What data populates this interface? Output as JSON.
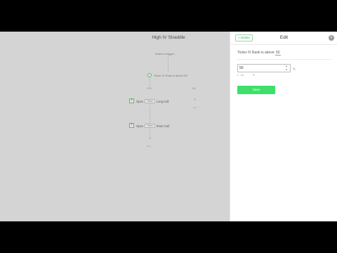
{
  "strategy": {
    "title": "High IV Straddle",
    "trigger": "Select a trigger...",
    "condition": "Ticker IV Rank is above 50",
    "branch_yes": "YES",
    "branch_no": "NO",
    "actions": [
      {
        "verb": "Open",
        "qty": "Ticker",
        "label": "Long Call"
      },
      {
        "verb": "Open",
        "qty": "Ticker",
        "label": "Short Call"
      }
    ],
    "end_label": "End"
  },
  "panel": {
    "back_label": "< Delete",
    "title": "Edit",
    "close_icon": "close-icon",
    "condition_prefix": "Ticker IV Rank",
    "condition_op": "is above",
    "condition_value": "50",
    "input_value": "50",
    "hint": "0 - 100",
    "save_label": "Save"
  },
  "colors": {
    "accent": "#3ee06a",
    "canvas_dim": "#d4d4d4",
    "node_outline": "#6bb37a"
  }
}
